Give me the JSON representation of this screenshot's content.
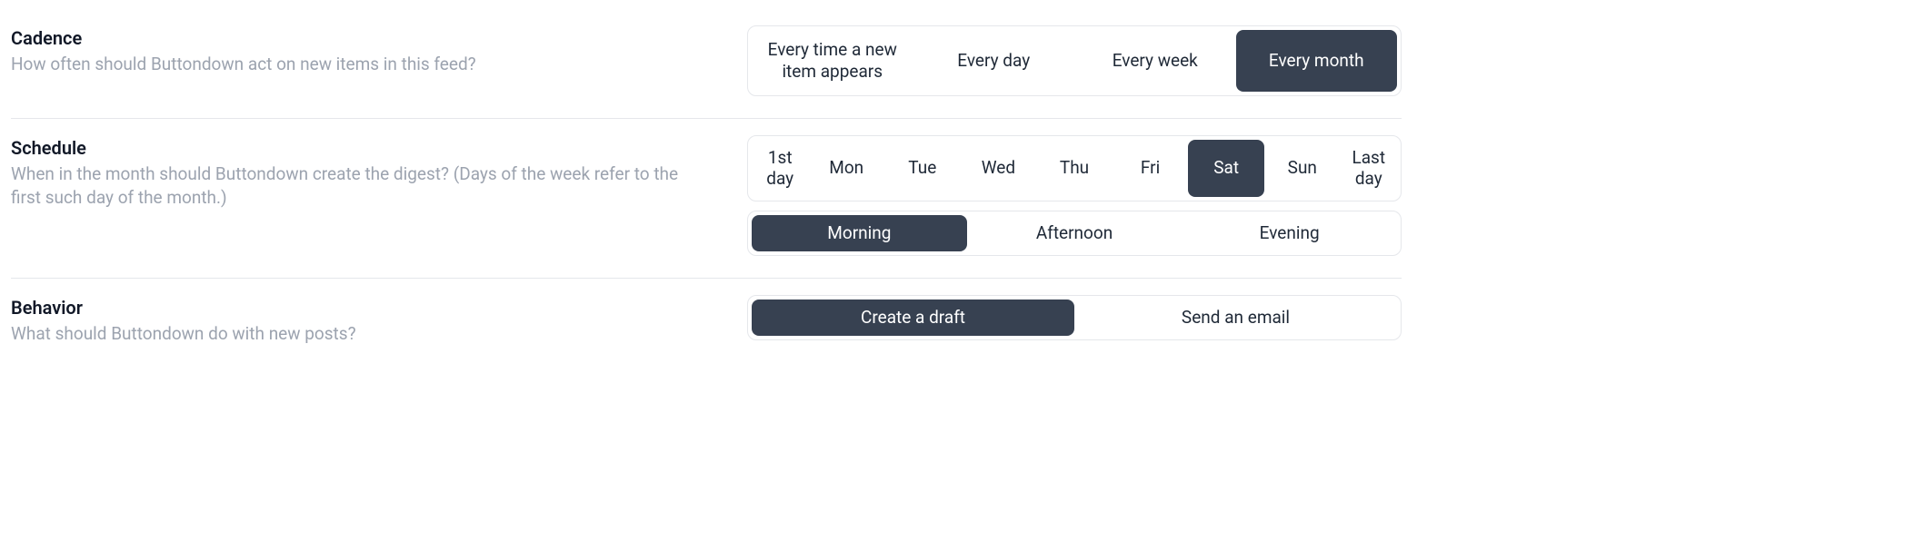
{
  "cadence": {
    "title": "Cadence",
    "subtitle": "How often should Buttondown act on new items in this feed?",
    "options": [
      "Every time a new item appears",
      "Every day",
      "Every week",
      "Every month"
    ],
    "selected_index": 3
  },
  "schedule": {
    "title": "Schedule",
    "subtitle": "When in the month should Buttondown create the digest? (Days of the week refer to the first such day of the month.)",
    "days": [
      "1st day",
      "Mon",
      "Tue",
      "Wed",
      "Thu",
      "Fri",
      "Sat",
      "Sun",
      "Last day"
    ],
    "selected_day_index": 6,
    "times": [
      "Morning",
      "Afternoon",
      "Evening"
    ],
    "selected_time_index": 0
  },
  "behavior": {
    "title": "Behavior",
    "subtitle": "What should Buttondown do with new posts?",
    "options": [
      "Create a draft",
      "Send an email"
    ],
    "selected_index": 0
  }
}
